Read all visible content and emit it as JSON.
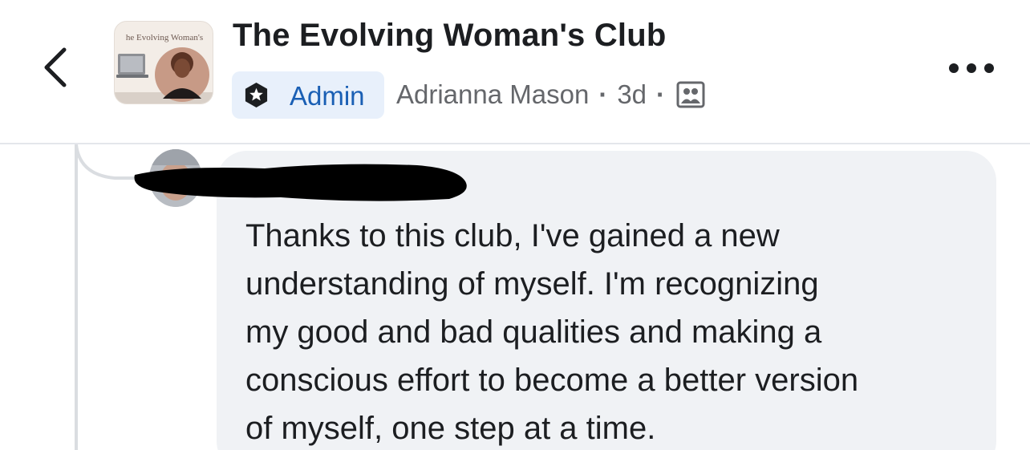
{
  "header": {
    "back_icon": "chevron-left-icon",
    "group_thumbnail_text": "he Evolving Woman's",
    "group_title": "The Evolving Woman's Club",
    "admin_badge": {
      "icon": "star-shield-icon",
      "label": "Admin"
    },
    "author": "Adrianna Mason",
    "separator": "·",
    "timestamp": "3d",
    "audience_icon": "group-members-icon",
    "more_icon": "more-horizontal-icon"
  },
  "comment": {
    "commenter_name": "",
    "name_redacted": true,
    "text": "Thanks to this club, I've gained a new\nunderstanding of myself. I'm recognizing\nmy good and bad qualities and making a\nconscious effort to become a better version\nof myself, one step at a time."
  },
  "colors": {
    "title_text": "#1c1e21",
    "meta_text": "#65676b",
    "admin_accent": "#1a5fb4",
    "admin_badge_bg": "#e8f0fb",
    "bubble_bg": "#f0f2f5",
    "redaction": "#000000"
  }
}
